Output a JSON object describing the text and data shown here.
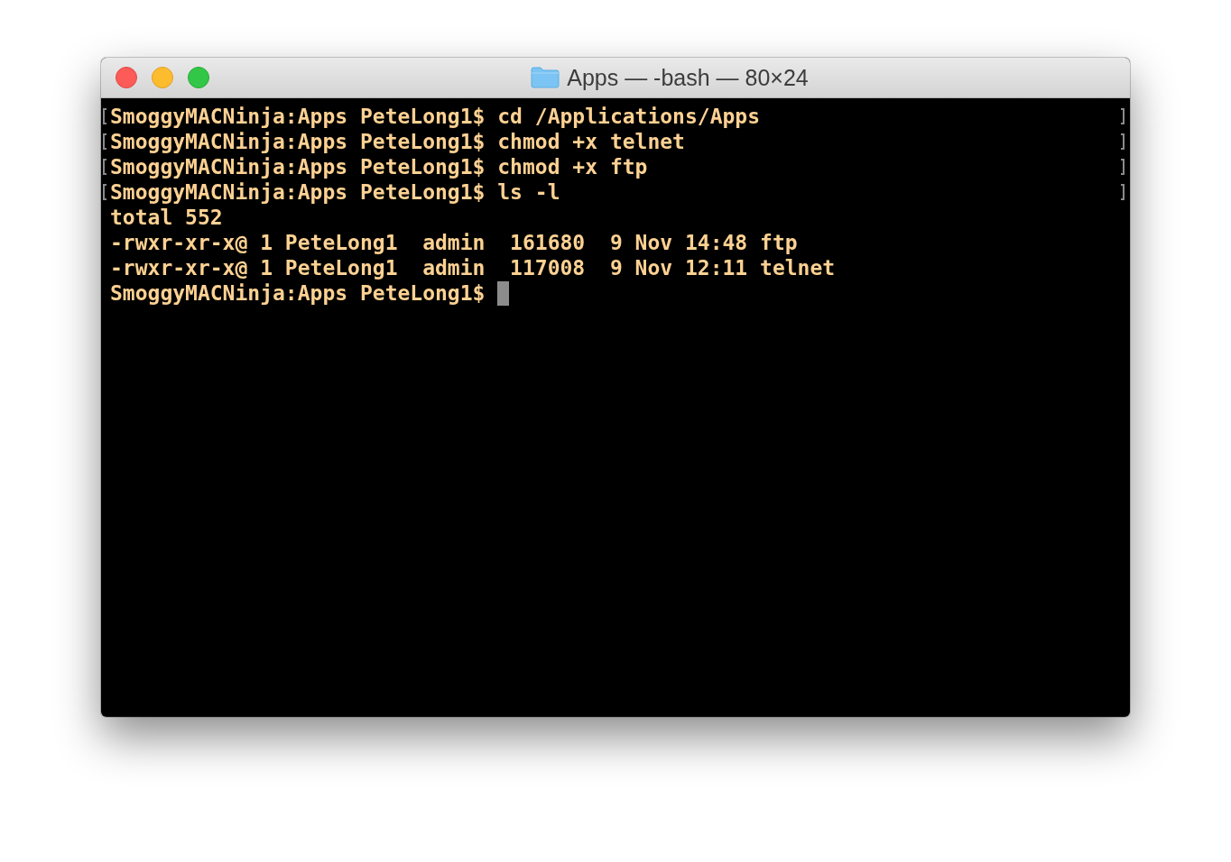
{
  "window": {
    "title": "Apps — -bash — 80×24"
  },
  "lines": [
    {
      "text": "SmoggyMACNinja:Apps PeteLong1$ cd /Applications/Apps",
      "marked": true,
      "cursor": false
    },
    {
      "text": "SmoggyMACNinja:Apps PeteLong1$ chmod +x telnet",
      "marked": true,
      "cursor": false
    },
    {
      "text": "SmoggyMACNinja:Apps PeteLong1$ chmod +x ftp",
      "marked": true,
      "cursor": false
    },
    {
      "text": "SmoggyMACNinja:Apps PeteLong1$ ls -l",
      "marked": true,
      "cursor": false
    },
    {
      "text": "total 552",
      "marked": false,
      "cursor": false
    },
    {
      "text": "-rwxr-xr-x@ 1 PeteLong1  admin  161680  9 Nov 14:48 ftp",
      "marked": false,
      "cursor": false
    },
    {
      "text": "-rwxr-xr-x@ 1 PeteLong1  admin  117008  9 Nov 12:11 telnet",
      "marked": false,
      "cursor": false
    },
    {
      "text": "SmoggyMACNinja:Apps PeteLong1$",
      "marked": false,
      "cursor": true
    }
  ]
}
